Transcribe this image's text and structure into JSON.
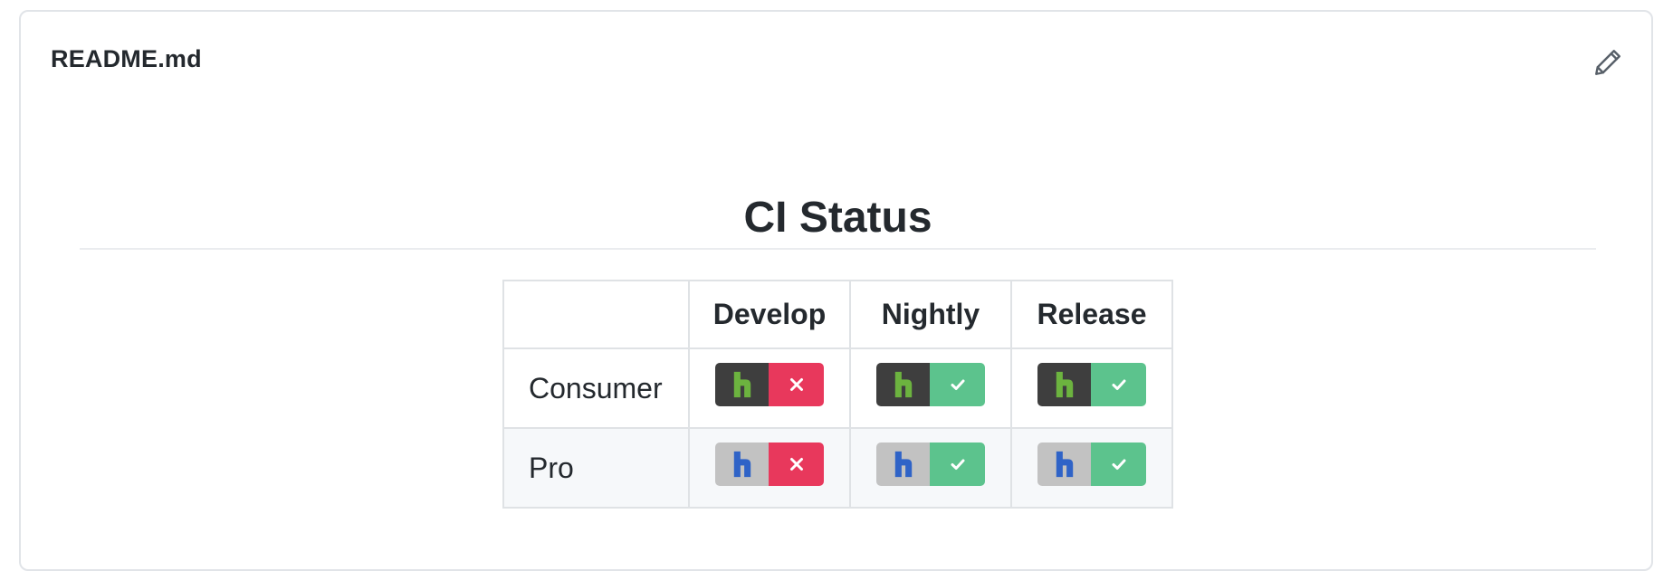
{
  "readme": {
    "filename": "README.md",
    "edit_icon": "pencil-icon",
    "heading": "CI Status"
  },
  "table": {
    "headers": [
      "",
      "Develop",
      "Nightly",
      "Release"
    ],
    "rows": [
      {
        "label": "Consumer",
        "variant": "consumer",
        "statuses": [
          "failing",
          "passing",
          "passing"
        ]
      },
      {
        "label": "Pro",
        "variant": "pro",
        "statuses": [
          "failing",
          "passing",
          "passing"
        ]
      }
    ]
  },
  "colors": {
    "consumer_logo_bg": "#3e3e3e",
    "consumer_logo_fg": "#6cb33f",
    "pro_logo_bg": "#c2c2c2",
    "pro_logo_fg": "#2f63c7",
    "failing": "#e8385c",
    "passing": "#5cc38d"
  }
}
